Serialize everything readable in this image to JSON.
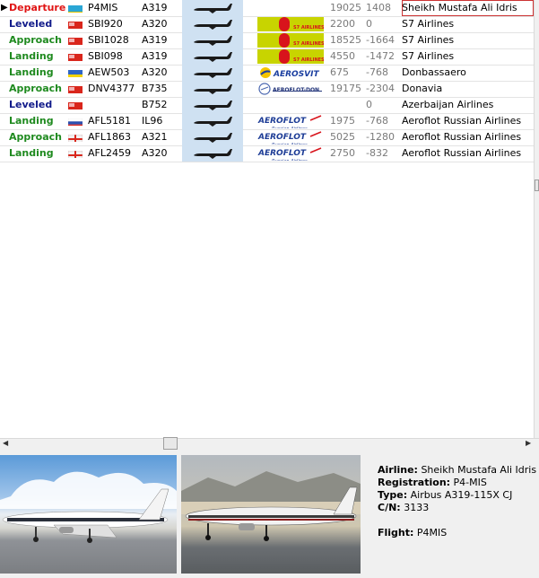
{
  "colors": {
    "departure": "#e01414",
    "leveled": "#101a8a",
    "approach": "#1f8a1f",
    "landing": "#1f8a1f",
    "silhouette_bg": "#cfe1f2",
    "s7_logo_bg": "#c8d400",
    "selected_border": "#cc3333"
  },
  "rows": [
    {
      "status": "Departure",
      "status_color": "#e01414",
      "flag": "kazakhstan-flag",
      "callsign": "P4MIS",
      "actype": "A319",
      "logo": "",
      "altitude": "19025",
      "vspeed": "1408",
      "airline": "Sheikh Mustafa Ali Idris",
      "selected": true
    },
    {
      "status": "Leveled",
      "status_color": "#101a8a",
      "flag": "red-flag",
      "callsign": "SBI920",
      "actype": "A320",
      "logo": "s7",
      "altitude": "2200",
      "vspeed": "0",
      "airline": "S7 Airlines"
    },
    {
      "status": "Approach",
      "status_color": "#1f8a1f",
      "flag": "red-flag",
      "callsign": "SBI1028",
      "actype": "A319",
      "logo": "s7",
      "altitude": "18525",
      "vspeed": "-1664",
      "airline": "S7 Airlines"
    },
    {
      "status": "Landing",
      "status_color": "#1f8a1f",
      "flag": "red-flag",
      "callsign": "SBI098",
      "actype": "A319",
      "logo": "s7",
      "altitude": "4550",
      "vspeed": "-1472",
      "airline": "S7 Airlines"
    },
    {
      "status": "Landing",
      "status_color": "#1f8a1f",
      "flag": "ukraine-flag",
      "callsign": "AEW503",
      "actype": "A320",
      "logo": "aerosvit",
      "altitude": "675",
      "vspeed": "-768",
      "airline": "Donbassaero"
    },
    {
      "status": "Approach",
      "status_color": "#1f8a1f",
      "flag": "red-flag",
      "callsign": "DNV4377",
      "actype": "B735",
      "logo": "aeroflot-don",
      "altitude": "19175",
      "vspeed": "-2304",
      "airline": "Donavia"
    },
    {
      "status": "Leveled",
      "status_color": "#101a8a",
      "flag": "red-flag",
      "callsign": "",
      "actype": "B752",
      "logo": "",
      "altitude": "",
      "vspeed": "0",
      "airline": "Azerbaijan Airlines"
    },
    {
      "status": "Landing",
      "status_color": "#1f8a1f",
      "flag": "russia-flag",
      "callsign": "AFL5181",
      "actype": "IL96",
      "logo": "aeroflot",
      "altitude": "1975",
      "vspeed": "-768",
      "airline": "Aeroflot Russian Airlines"
    },
    {
      "status": "Approach",
      "status_color": "#1f8a1f",
      "flag": "uk-flag",
      "callsign": "AFL1863",
      "actype": "A321",
      "logo": "aeroflot",
      "altitude": "5025",
      "vspeed": "-1280",
      "airline": "Aeroflot Russian Airlines"
    },
    {
      "status": "Landing",
      "status_color": "#1f8a1f",
      "flag": "uk-flag",
      "callsign": "AFL2459",
      "actype": "A320",
      "logo": "aeroflot",
      "altitude": "2750",
      "vspeed": "-832",
      "airline": "Aeroflot Russian Airlines"
    }
  ],
  "logo_text": {
    "s7": "S7 AIRLINES",
    "aerosvit": "AEROSVIT",
    "aeroflot_don": "AEROFLOT-DON",
    "aeroflot": "AEROFLOT",
    "aeroflot_sub": "Russian Airlines"
  },
  "details": {
    "airline_label": "Airline:",
    "airline_value": "Sheikh Mustafa Ali Idris",
    "registration_label": "Registration:",
    "registration_value": "P4-MIS",
    "type_label": "Type:",
    "type_value": "Airbus A319-115X CJ",
    "cn_label": "C/N:",
    "cn_value": "3133",
    "flight_label": "Flight:",
    "flight_value": "P4MIS"
  }
}
